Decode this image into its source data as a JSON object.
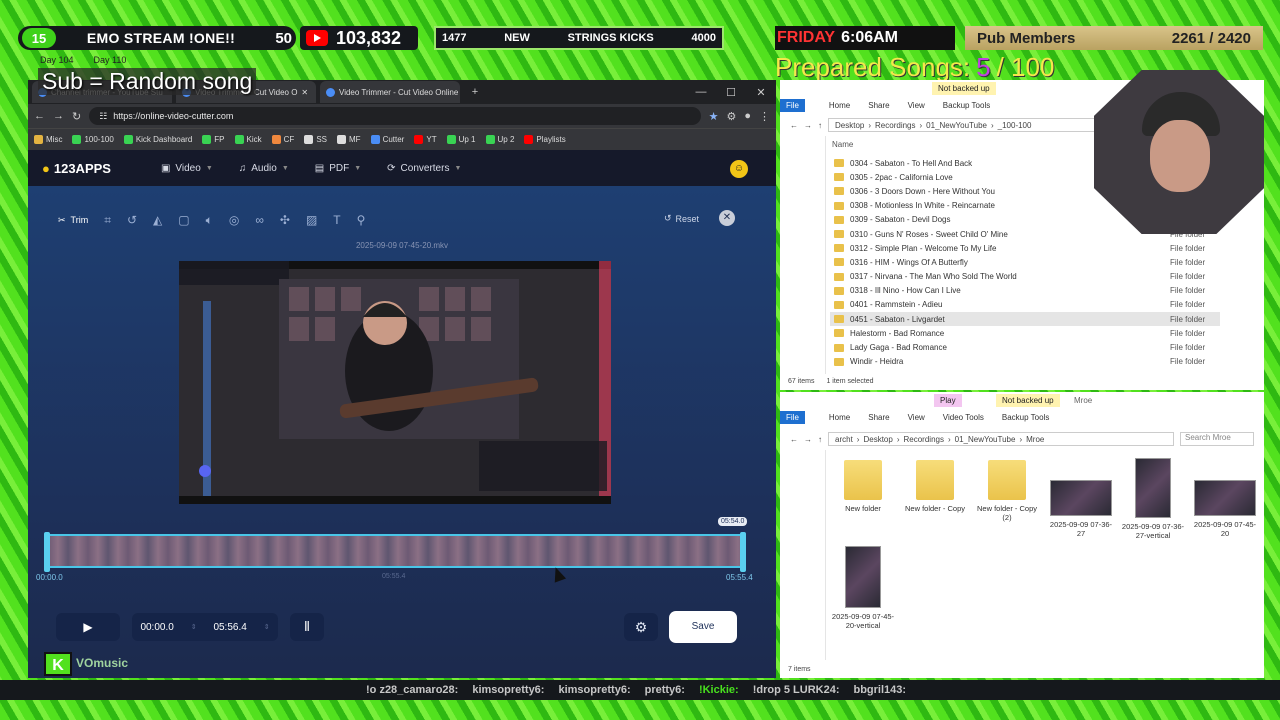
{
  "overlay": {
    "day_num": "15",
    "stream_name": "EMO STREAM !ONE!!",
    "level": "50",
    "yt_subs": "103,832",
    "kicks_left": "1477",
    "kicks_new": "NEW",
    "kicks_label": "STRINGS KICKS",
    "kicks_goal": "4000",
    "weekday": "FRIDAY",
    "time": "6:06AM",
    "pub_label": "Pub Members",
    "pub_count": "2261 / 2420",
    "prepared_label": "Prepared Songs:",
    "prepared_num": "5",
    "prepared_total": "/ 100",
    "sub_song": "Sub = Random song",
    "day_a": "Day 104",
    "day_b": "Day 110"
  },
  "browser": {
    "tabs": [
      {
        "label": "Channel trimmer - YouTube Stu"
      },
      {
        "label": "Video Trimmer - Cut Video O"
      },
      {
        "label": "Video Trimmer - Cut Video Online"
      }
    ],
    "url": "https://online-video-cutter.com",
    "bookmarks": [
      "Misc",
      "100-100",
      "Kick Dashboard",
      "FP",
      "Kick",
      "CF",
      "SS",
      "MF",
      "Cutter",
      "YT",
      "Up 1",
      "Up 2",
      "Playlists"
    ]
  },
  "app": {
    "logo": "123APPS",
    "nav": [
      "Video",
      "Audio",
      "PDF",
      "Converters"
    ],
    "trim_label": "Trim",
    "reset_label": "Reset",
    "filename": "2025-09-09 07-45-20.mkv",
    "badge_time": "05:54.0",
    "start_time": "00:00.0",
    "mid_time": "05:55.4",
    "end_time": "05:55.4",
    "time_from": "00:00.0",
    "time_to": "05:56.4",
    "save_label": "Save"
  },
  "explorer_top": {
    "ribbon": {
      "file": "File",
      "tabs": [
        "Home",
        "Share",
        "View",
        "Backup Tools"
      ],
      "context": "Not backed up"
    },
    "path": [
      "Desktop",
      "Recordings",
      "01_NewYouTube",
      "_100-100"
    ],
    "column": "Name",
    "rows": [
      {
        "name": "0304 - Sabaton - To Hell And Back",
        "type": "File folder"
      },
      {
        "name": "0305 - 2pac - California Love",
        "type": "File folder"
      },
      {
        "name": "0306 - 3 Doors Down - Here Without You",
        "type": "File folder"
      },
      {
        "name": "0308 - Motionless In White - Reincarnate",
        "type": "File folder"
      },
      {
        "name": "0309 - Sabaton - Devil Dogs",
        "type": "File folder"
      },
      {
        "name": "0310 - Guns N' Roses - Sweet Child O' Mine",
        "type": "File folder"
      },
      {
        "name": "0312 - Simple Plan - Welcome To My Life",
        "type": "File folder"
      },
      {
        "name": "0316 - HIM - Wings Of A Butterfly",
        "type": "File folder"
      },
      {
        "name": "0317 - Nirvana - The Man Who Sold The World",
        "type": "File folder"
      },
      {
        "name": "0318 - Ill Nino - How Can I Live",
        "type": "File folder"
      },
      {
        "name": "0401 - Rammstein - Adieu",
        "type": "File folder"
      },
      {
        "name": "0451 - Sabaton - Livgardet",
        "type": "File folder"
      },
      {
        "name": "Halestorm - Bad Romance",
        "type": "File folder"
      },
      {
        "name": "Lady Gaga - Bad Romance",
        "type": "File folder"
      },
      {
        "name": "Windir - Heidra",
        "type": "File folder"
      }
    ],
    "status_items": "67 items",
    "status_selected": "1 item selected"
  },
  "explorer_bottom": {
    "ribbon": {
      "file": "File",
      "tabs": [
        "Home",
        "Share",
        "View"
      ],
      "play": "Play",
      "context": "Not backed up",
      "folder": "Mroe",
      "video_tools": "Video Tools",
      "backup_tools": "Backup Tools"
    },
    "path": [
      "archt",
      "Desktop",
      "Recordings",
      "01_NewYouTube",
      "Mroe"
    ],
    "search_placeholder": "Search Mroe",
    "items": [
      {
        "label": "New folder"
      },
      {
        "label": "New folder - Copy"
      },
      {
        "label": "New folder - Copy (2)"
      },
      {
        "label": "2025-09-09 07-36-27"
      },
      {
        "label": "2025-09-09 07-36-27-vertical"
      },
      {
        "label": "2025-09-09 07-45-20"
      },
      {
        "label": "2025-09-09 07-45-20-vertical"
      }
    ],
    "status_items": "7 items"
  },
  "ticker": {
    "messages": [
      "!o z28_camaro28:",
      "kimsopretty6:",
      "kimsopretty6:",
      "pretty6:",
      "!Kickie:",
      "!drop 5 LURK24:",
      "bbgril143:"
    ],
    "vomusic": "VOmusic"
  },
  "colors": {
    "accent": "#4a8df5",
    "frame_green": "#52e11e",
    "youtube_red": "#ff0000"
  }
}
